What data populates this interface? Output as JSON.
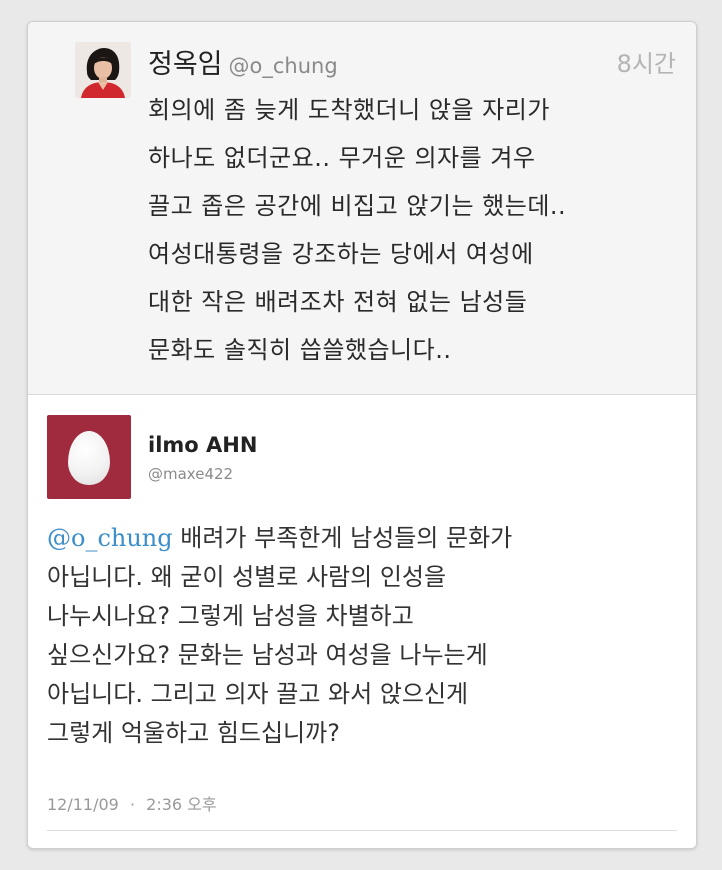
{
  "original_tweet": {
    "author_name": "정옥임",
    "handle": "@o_chung",
    "time": "8시간",
    "lines": [
      "회의에 좀 늦게 도착했더니 앉을 자리가",
      "하나도 없더군요.. 무거운 의자를 겨우",
      "끌고 좁은 공간에 비집고 앉기는 했는데..",
      "여성대통령을 강조하는 당에서 여성에",
      "대한 작은 배려조차 전혀 없는 남성들",
      "문화도 솔직히 씁쓸했습니다.."
    ]
  },
  "reply_tweet": {
    "author_name": "ilmo AHN",
    "handle": "@maxe422",
    "mention": "@o_chung",
    "lines": [
      " 배려가 부족한게 남성들의 문화가",
      "아닙니다. 왜 굳이 성별로 사람의 인성을",
      "나누시나요? 그렇게 남성을 차별하고",
      "싶으신가요? 문화는 남성과 여성을 나누는게",
      "아닙니다. 그리고 의자 끌고 와서 앉으신게",
      "그렇게 억울하고 힘드십니까?"
    ],
    "date": "12/11/09",
    "separator": "·",
    "time": "2:36 오후"
  },
  "colors": {
    "mention": "#3b8ec9",
    "egg_avatar_bg": "#a02a3e",
    "original_bg": "#f5f5f5"
  },
  "icons": [
    "profile-photo",
    "default-egg-avatar"
  ]
}
